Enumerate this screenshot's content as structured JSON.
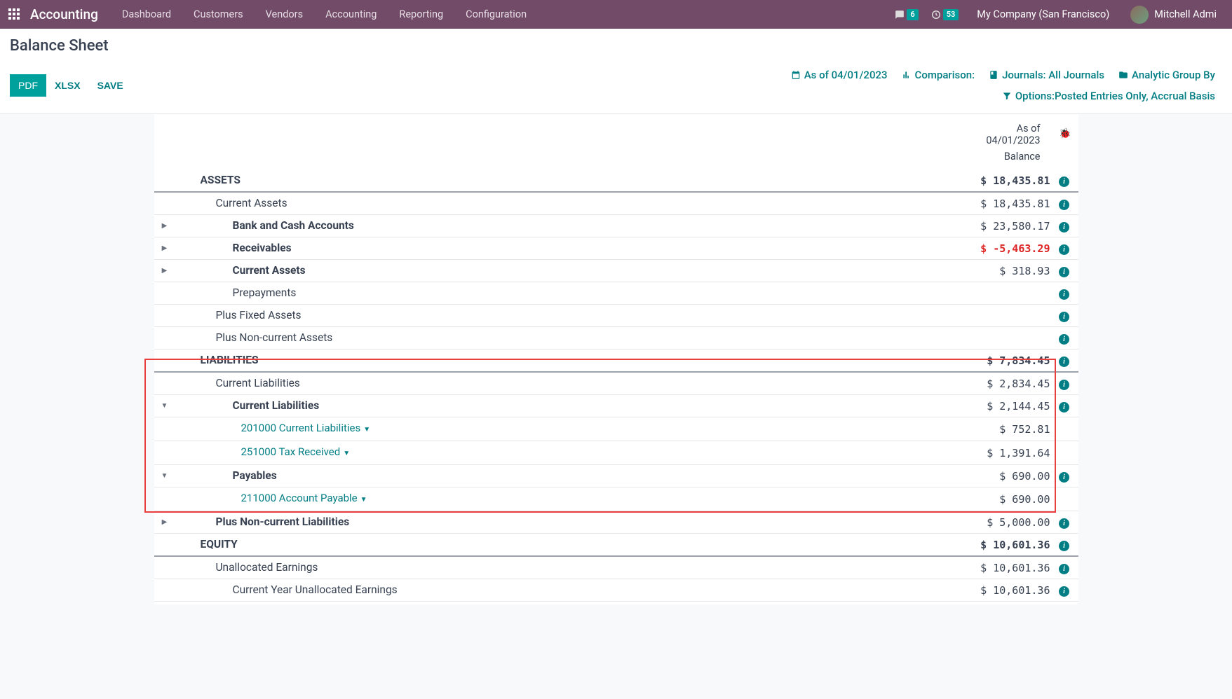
{
  "nav": {
    "brand": "Accounting",
    "links": [
      "Dashboard",
      "Customers",
      "Vendors",
      "Accounting",
      "Reporting",
      "Configuration"
    ],
    "msg_badge": "6",
    "act_badge": "53",
    "company": "My Company (San Francisco)",
    "user": "Mitchell Admi"
  },
  "page": {
    "title": "Balance Sheet",
    "btn_pdf": "PDF",
    "btn_xlsx": "XLSX",
    "btn_save": "SAVE",
    "opt_asof": "As of 04/01/2023",
    "opt_comparison": "Comparison:",
    "opt_journals": "Journals: All Journals",
    "opt_analytic": "Analytic Group By",
    "opt_options": "Options:Posted Entries Only, Accrual Basis"
  },
  "col": {
    "asof1": "As of",
    "asof2": "04/01/2023",
    "balance": "Balance"
  },
  "rows": {
    "assets": {
      "label": "ASSETS",
      "val": "$ 18,435.81"
    },
    "ca": {
      "label": "Current Assets",
      "val": "$ 18,435.81"
    },
    "bank": {
      "label": "Bank and Cash Accounts",
      "val": "$ 23,580.17"
    },
    "recv": {
      "label": "Receivables",
      "val": "$ -5,463.29"
    },
    "ca2": {
      "label": "Current Assets",
      "val": "$ 318.93"
    },
    "prepay": {
      "label": "Prepayments",
      "val": ""
    },
    "fixed": {
      "label": "Plus Fixed Assets",
      "val": ""
    },
    "nca": {
      "label": "Plus Non-current Assets",
      "val": ""
    },
    "liab": {
      "label": "LIABILITIES",
      "val": "$ 7,834.45"
    },
    "cl": {
      "label": "Current Liabilities",
      "val": "$ 2,834.45"
    },
    "cl2": {
      "label": "Current Liabilities",
      "val": "$ 2,144.45"
    },
    "a201": {
      "label": "201000 Current Liabilities",
      "val": "$ 752.81"
    },
    "a251": {
      "label": "251000 Tax Received",
      "val": "$ 1,391.64"
    },
    "pay": {
      "label": "Payables",
      "val": "$ 690.00"
    },
    "a211": {
      "label": "211000 Account Payable",
      "val": "$ 690.00"
    },
    "ncl": {
      "label": "Plus Non-current Liabilities",
      "val": "$ 5,000.00"
    },
    "equity": {
      "label": "EQUITY",
      "val": "$ 10,601.36"
    },
    "unalloc": {
      "label": "Unallocated Earnings",
      "val": "$ 10,601.36"
    },
    "cyue": {
      "label": "Current Year Unallocated Earnings",
      "val": "$ 10,601.36"
    }
  }
}
